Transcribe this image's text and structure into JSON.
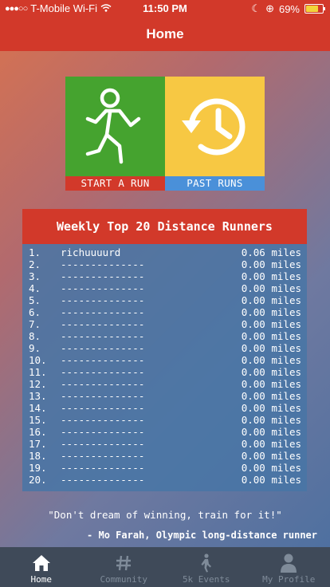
{
  "status": {
    "carrier": "T-Mobile Wi-Fi",
    "time": "11:50 PM",
    "battery": "69%"
  },
  "nav": {
    "title": "Home"
  },
  "tiles": {
    "start_label": "START A RUN",
    "past_label": "PAST RUNS"
  },
  "leaderboard": {
    "title": "Weekly Top 20 Distance Runners",
    "rows": [
      {
        "rank": "1.",
        "name": "richuuuurd",
        "distance": "0.06 miles"
      },
      {
        "rank": "2.",
        "name": "--------------",
        "distance": "0.00 miles"
      },
      {
        "rank": "3.",
        "name": "--------------",
        "distance": "0.00 miles"
      },
      {
        "rank": "4.",
        "name": "--------------",
        "distance": "0.00 miles"
      },
      {
        "rank": "5.",
        "name": "--------------",
        "distance": "0.00 miles"
      },
      {
        "rank": "6.",
        "name": "--------------",
        "distance": "0.00 miles"
      },
      {
        "rank": "7.",
        "name": "--------------",
        "distance": "0.00 miles"
      },
      {
        "rank": "8.",
        "name": "--------------",
        "distance": "0.00 miles"
      },
      {
        "rank": "9.",
        "name": "--------------",
        "distance": "0.00 miles"
      },
      {
        "rank": "10.",
        "name": "--------------",
        "distance": "0.00 miles"
      },
      {
        "rank": "11.",
        "name": "--------------",
        "distance": "0.00 miles"
      },
      {
        "rank": "12.",
        "name": "--------------",
        "distance": "0.00 miles"
      },
      {
        "rank": "13.",
        "name": "--------------",
        "distance": "0.00 miles"
      },
      {
        "rank": "14.",
        "name": "--------------",
        "distance": "0.00 miles"
      },
      {
        "rank": "15.",
        "name": "--------------",
        "distance": "0.00 miles"
      },
      {
        "rank": "16.",
        "name": "--------------",
        "distance": "0.00 miles"
      },
      {
        "rank": "17.",
        "name": "--------------",
        "distance": "0.00 miles"
      },
      {
        "rank": "18.",
        "name": "--------------",
        "distance": "0.00 miles"
      },
      {
        "rank": "19.",
        "name": "--------------",
        "distance": "0.00 miles"
      },
      {
        "rank": "20.",
        "name": "--------------",
        "distance": "0.00 miles"
      }
    ]
  },
  "quote": {
    "text": "\"Don't dream of winning, train for it!\"",
    "author": "- Mo Farah, Olympic long-distance runner"
  },
  "tabs": [
    {
      "label": "Home",
      "icon": "home-icon",
      "active": true
    },
    {
      "label": "Community",
      "icon": "hash-icon",
      "active": false
    },
    {
      "label": "5k Events",
      "icon": "runner-icon",
      "active": false
    },
    {
      "label": "My Profile",
      "icon": "person-icon",
      "active": false
    }
  ],
  "colors": {
    "accent_red": "#d2392a",
    "start_green": "#45a32f",
    "past_yellow": "#f7c843",
    "past_blue": "#4a90d9",
    "tabbar": "#3f4a59"
  }
}
